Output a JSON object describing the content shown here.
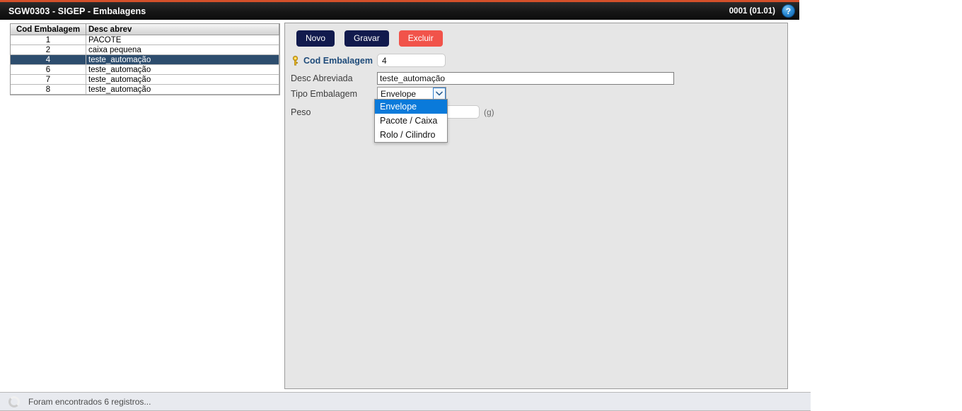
{
  "titlebar": {
    "title": "SGW0303 - SIGEP - Embalagens",
    "version": "0001 (01.01)",
    "help_icon": "question-mark-icon",
    "help_label": "?"
  },
  "grid": {
    "columns": [
      "Cod Embalagem",
      "Desc abrev"
    ],
    "rows": [
      {
        "cod": "1",
        "desc": "PACOTE",
        "selected": false
      },
      {
        "cod": "2",
        "desc": "caixa pequena",
        "selected": false
      },
      {
        "cod": "4",
        "desc": "teste_automação",
        "selected": true
      },
      {
        "cod": "6",
        "desc": "teste_automação",
        "selected": false
      },
      {
        "cod": "7",
        "desc": "teste_automação",
        "selected": false
      },
      {
        "cod": "8",
        "desc": "teste_automação",
        "selected": false
      }
    ]
  },
  "form": {
    "buttons": {
      "novo": "Novo",
      "gravar": "Gravar",
      "excluir": "Excluir"
    },
    "fields": {
      "cod_embalagem": {
        "label": "Cod Embalagem",
        "value": "4",
        "icon": "key-icon"
      },
      "desc_abreviada": {
        "label": "Desc Abreviada",
        "value": "teste_automação"
      },
      "tipo_embalagem": {
        "label": "Tipo Embalagem",
        "value": "Envelope",
        "options": [
          "Envelope",
          "Pacote / Caixa",
          "Rolo / Cilindro"
        ],
        "highlighted": "Envelope",
        "expanded": true
      },
      "peso": {
        "label": "Peso",
        "value": "",
        "unit": "(g)"
      }
    }
  },
  "statusbar": {
    "message": "Foram encontrados 6 registros...",
    "icon": "loading-spinner-icon"
  },
  "colors": {
    "titlebar_bg": "#161616",
    "titlebar_accent": "#d4502a",
    "selected_row": "#2d4d6e",
    "primary_button": "#111a4d",
    "danger_button": "#f1534a",
    "dropdown_highlight": "#0a7ada",
    "key_label": "#1e4b7a",
    "panel_bg": "#e6e6e6",
    "statusbar_bg": "#e8eaef"
  }
}
